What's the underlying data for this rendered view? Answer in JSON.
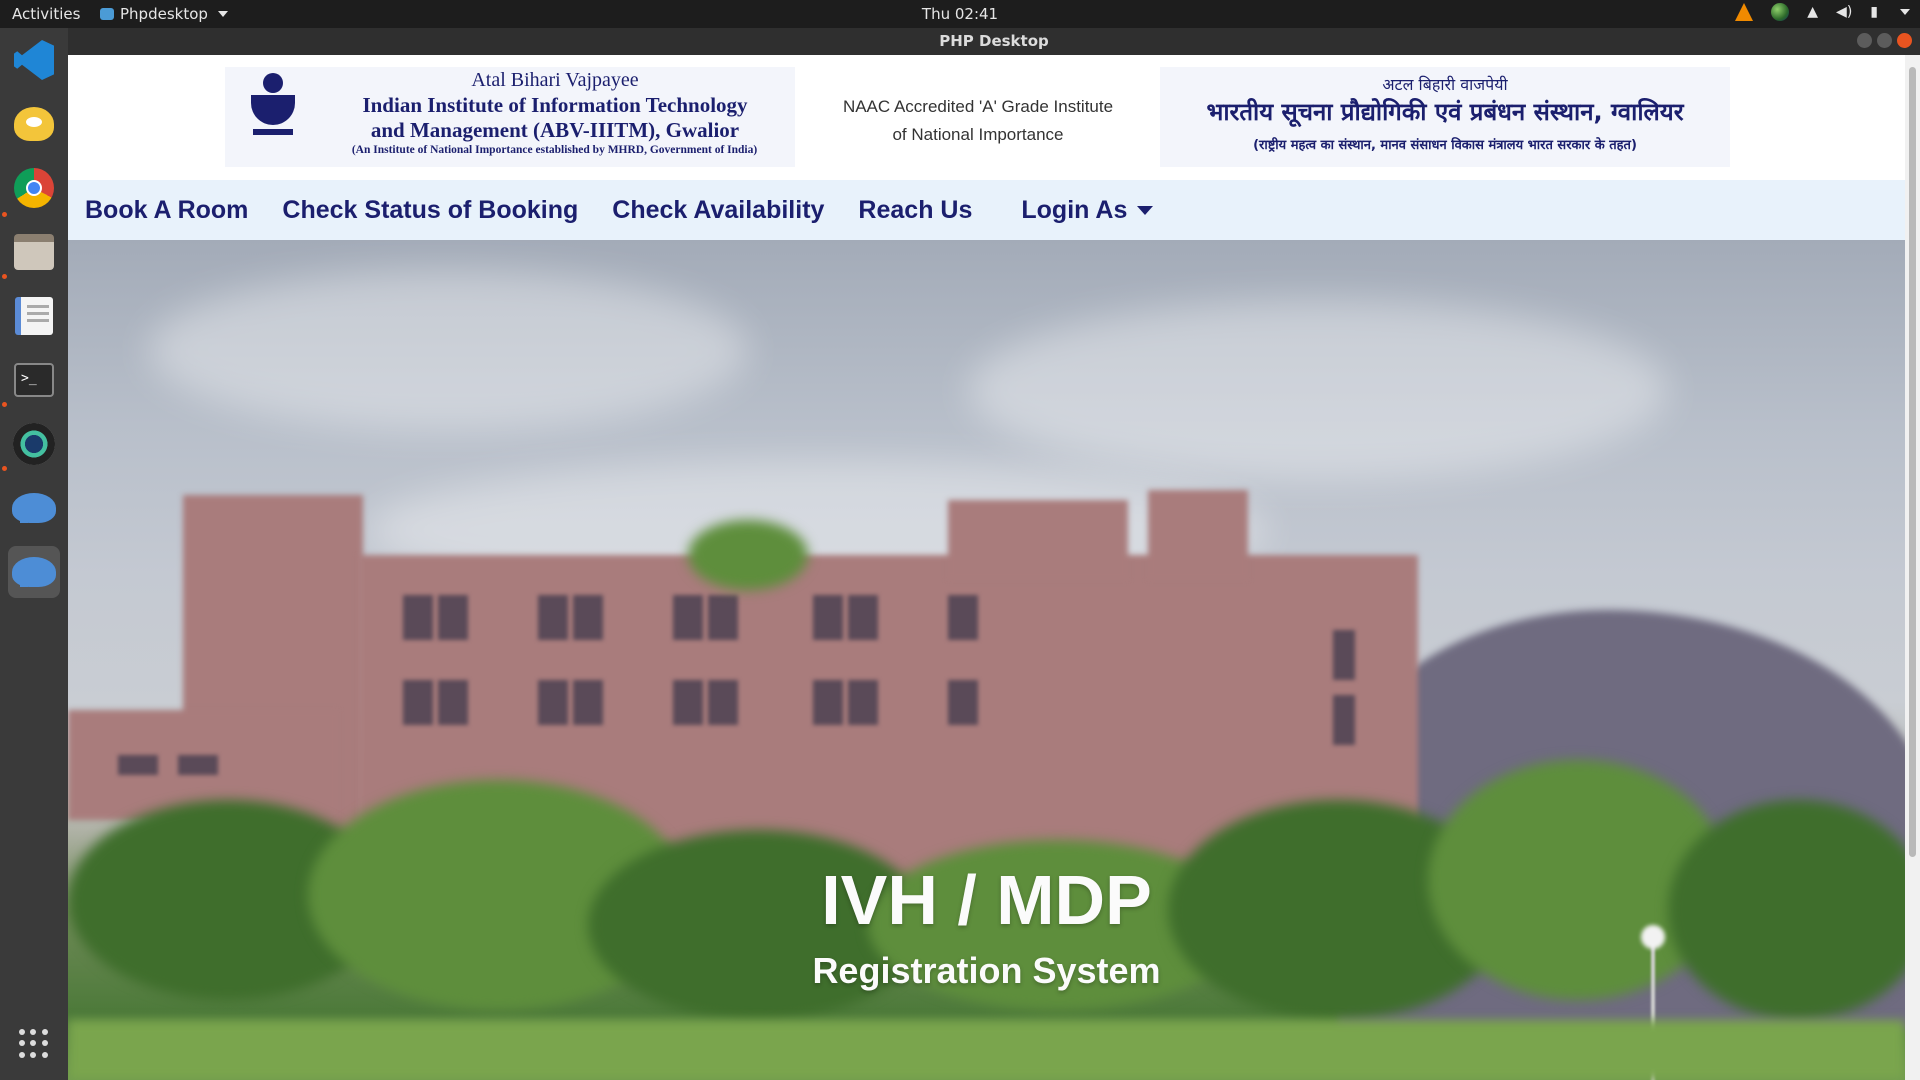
{
  "topbar": {
    "activities": "Activities",
    "app_name": "Phpdesktop",
    "clock": "Thu 02:41",
    "tray_icons": [
      "vlc-icon",
      "globe-icon",
      "wifi-icon",
      "volume-icon",
      "battery-icon",
      "system-menu-icon"
    ]
  },
  "window": {
    "title": "PHP Desktop"
  },
  "dock": {
    "items": [
      "vscode-icon",
      "teapot-icon",
      "chrome-icon",
      "files-icon",
      "text-editor-icon",
      "terminal-icon",
      "camera-icon",
      "php-desktop-icon",
      "php-desktop-active-icon"
    ],
    "show_apps": "show-applications-icon"
  },
  "header": {
    "left_logo": {
      "line1": "Atal Bihari Vajpayee",
      "line2": "Indian Institute of Information Technology",
      "line3": "and Management (ABV-IIITM), Gwalior",
      "line4": "(An Institute of National Importance established by MHRD, Government of India)"
    },
    "naac": {
      "line1": "NAAC Accredited 'A' Grade Institute",
      "line2": "of National Importance"
    },
    "right_logo": {
      "line1": "अटल बिहारी वाजपेयी",
      "line2": "भारतीय सूचना प्रौद्योगिकी एवं प्रबंधन संस्थान, ग्वालियर",
      "line3": "(राष्ट्रीय महत्व का संस्थान, मानव संसाधन विकास मंत्रालय भारत सरकार के तहत)"
    }
  },
  "nav": {
    "items": [
      {
        "label": "Book A Room"
      },
      {
        "label": "Check Status of Booking"
      },
      {
        "label": "Check Availability"
      },
      {
        "label": "Reach Us"
      },
      {
        "label": "Login As"
      }
    ]
  },
  "hero": {
    "title": "IVH / MDP",
    "subtitle": "Registration System"
  },
  "colors": {
    "nav_bg": "#e8f2fb",
    "nav_text": "#1b1f6e",
    "accent": "#e95420"
  }
}
